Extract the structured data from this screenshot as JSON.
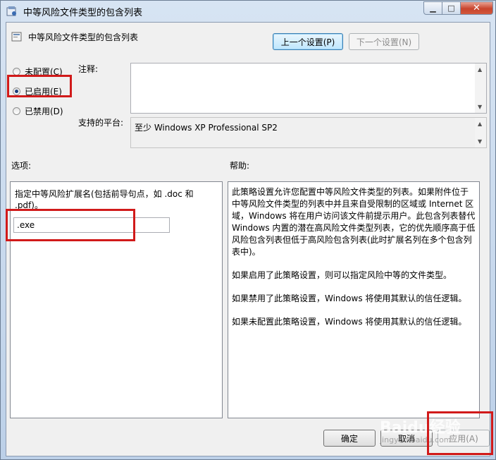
{
  "window": {
    "title": "中等风险文件类型的包含列表",
    "heading": "中等风险文件类型的包含列表"
  },
  "nav": {
    "prev_label": "上一个设置(P)",
    "next_label": "下一个设置(N)"
  },
  "state": {
    "options": [
      {
        "label": "未配置(C)",
        "checked": false
      },
      {
        "label": "已启用(E)",
        "checked": true
      },
      {
        "label": "已禁用(D)",
        "checked": false
      }
    ]
  },
  "comment": {
    "label": "注释:",
    "value": ""
  },
  "platform": {
    "label": "支持的平台:",
    "value": "至少 Windows XP Professional SP2"
  },
  "options_section": {
    "label": "选项:",
    "description": "指定中等风险扩展名(包括前导句点，如 .doc 和 .pdf)。",
    "value": ".exe"
  },
  "help_section": {
    "label": "帮助:",
    "paragraphs": [
      "此策略设置允许您配置中等风险文件类型的列表。如果附件位于中等风险文件类型的列表中并且来自受限制的区域或 Internet 区域，Windows 将在用户访问该文件前提示用户。此包含列表替代 Windows 内置的潜在高风险文件类型列表，它的优先顺序高于低风险包含列表但低于高风险包含列表(此时扩展名列在多个包含列表中)。",
      "如果启用了此策略设置，则可以指定风险中等的文件类型。",
      "如果禁用了此策略设置，Windows 将使用其默认的信任逻辑。",
      "如果未配置此策略设置，Windows 将使用其默认的信任逻辑。"
    ]
  },
  "footer": {
    "ok_label": "确定",
    "cancel_label": "取消",
    "apply_label": "应用(A)"
  },
  "watermark": {
    "text": "Baidu经验",
    "sub": "jingyan.baidu.com"
  },
  "colors": {
    "highlight": "#d11a1a",
    "accent": "#3c7fb1"
  }
}
